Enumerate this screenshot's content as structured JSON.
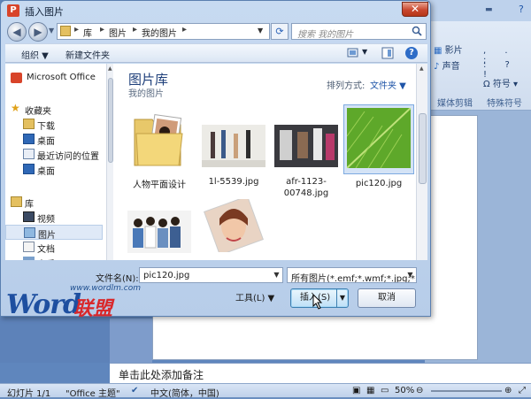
{
  "dialog": {
    "title": "插入图片",
    "title_icon_glyph": "P",
    "close_glyph": "✕",
    "breadcrumbs": [
      "库",
      "图片",
      "我的图片"
    ],
    "search_placeholder": "搜索 我的图片",
    "toolbar": {
      "organize": "组织 ▼",
      "new_folder": "新建文件夹",
      "help": "?"
    },
    "nav": {
      "top_item": "Microsoft Office",
      "favorites_header": "收藏夹",
      "favorites": [
        "下载",
        "桌面",
        "最近访问的位置",
        "桌面"
      ],
      "libraries_header": "库",
      "libraries": [
        "视频",
        "图片",
        "文档",
        "音乐"
      ]
    },
    "library": {
      "title": "图片库",
      "subtitle": "我的图片",
      "arrange_label": "排列方式:",
      "arrange_value": "文件夹 ▼"
    },
    "files": [
      {
        "name": "人物平面设计",
        "type": "folder"
      },
      {
        "name": "1l-5539.jpg",
        "type": "photo"
      },
      {
        "name": "afr-1123-00748.jpg",
        "type": "photo"
      },
      {
        "name": "pic120.jpg",
        "type": "photo",
        "selected": true
      },
      {
        "name": "",
        "type": "photo"
      },
      {
        "name": "",
        "type": "photo"
      }
    ],
    "filename_label": "文件名(N):",
    "filename_value": "pic120.jpg",
    "filter_value": "所有图片(*.emf;*.wmf;*.jpg;*.jp",
    "tools_label": "工具(L)   ▼",
    "insert_label": "插入(S)",
    "cancel_label": "取消",
    "dropdown_glyph": "▼"
  },
  "watermark": {
    "url": "www.wordlm.com",
    "logo": "Word",
    "logo_cn": "联盟"
  },
  "ppt": {
    "ribbon": {
      "movie": "影片",
      "sound": "声音",
      "symbol": "符号",
      "group_media": "媒体剪辑",
      "group_special": "特殊符号"
    },
    "notes_text": "单击此处添加备注",
    "status": {
      "slide": "幻灯片 1/1",
      "theme": "\"Office 主题\"",
      "lang": "中文(简体，中国)",
      "zoom": "50%"
    }
  },
  "colors": {
    "accent": "#1e3f7a",
    "close": "#c9472e",
    "selection": "#d4e3f6"
  }
}
